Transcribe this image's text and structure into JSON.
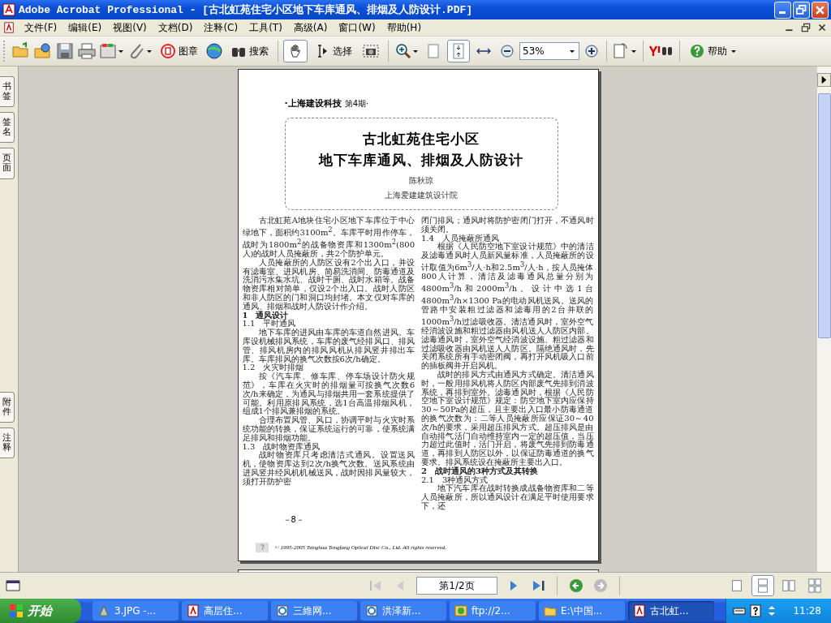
{
  "window": {
    "title": "Adobe Acrobat Professional - [古北虹苑住宅小区地下车库通风、排烟及人防设计.PDF]"
  },
  "menu": [
    "文件(F)",
    "编辑(E)",
    "视图(V)",
    "文档(D)",
    "注释(C)",
    "工具(T)",
    "高级(A)",
    "窗口(W)",
    "帮助(H)"
  ],
  "toolbar": {
    "stamp_label": "图章",
    "search_label": "搜索",
    "tools": [
      {
        "kind": "hand",
        "selected": true
      },
      {
        "kind": "select",
        "label": "选择",
        "selected": false
      },
      {
        "kind": "snapshot",
        "selected": false
      }
    ],
    "view_buttons": [
      {
        "kind": "actual",
        "selected": false
      },
      {
        "kind": "fit_page",
        "selected": true
      },
      {
        "kind": "fit_width",
        "selected": false
      }
    ],
    "zoom": "53%",
    "help_label": "帮助"
  },
  "left_panel": {
    "top_tabs": [
      "书签",
      "签名",
      "页面"
    ],
    "bottom_tabs": [
      "附件",
      "注释"
    ]
  },
  "document": {
    "journal": "·上海建设科技",
    "issue": "第4期·",
    "title_lines": [
      "古北虹苑住宅小区",
      "地下车库通风、排烟及人防设计"
    ],
    "author": "陈秋琼",
    "affiliation": "上海爱建建筑设计院",
    "columns": [
      [
        {
          "kind": "para",
          "text": "古北虹苑A地块住宅小区地下车库位于中心绿地下，面积约3100m$^{2}$。车库平时用作停车，战时为1800m$^{2}$的战备物资库和1300m$^{2}$(800人)的战时人员掩蔽所，共2个防护单元。"
        },
        {
          "kind": "para",
          "text": "人员掩蔽所的人防区设有2个出入口，并设有滤毒室、进风机房、简易洗消间、防毒通道及洗消污水集水坑、战时干厕、战时水箱等。战备物资库相对简单，仅设2个出入口。战时人防区和非人防区的门和洞口均封堵。本文仅对车库的通风、排烟和战时人防设计作介绍。"
        },
        {
          "kind": "section",
          "text": "1　通风设计"
        },
        {
          "kind": "subsection",
          "text": "1.1　平时通风"
        },
        {
          "kind": "para",
          "text": "地下车库的进风由车库的车道自然进风。车库设机械排风系统，车库的废气经排风口、排风管、排风机房内的排风风机从排风竖井排出车库。车库排风的换气次数按6次/h确定。"
        },
        {
          "kind": "subsection",
          "text": "1.2　火灾时排烟"
        },
        {
          "kind": "para",
          "text": "按《汽车库、修车库、停车场设计防火规范》，车库在火灾时的排烟量可按换气次数6次/h来确定，为通风与排烟共用一套系统提供了可能。利用原排风系统，选1台高温排烟风机，组成1个排风兼排烟的系统。"
        },
        {
          "kind": "para",
          "text": "合理布置风管、风口，协调平时与火灾时系统功能的转换，保证系统运行的可靠，使系统满足排风和排烟功能。"
        },
        {
          "kind": "subsection",
          "text": "1.3　战时物资库通风"
        },
        {
          "kind": "para",
          "text": "战时物资库只考虑清洁式通风。设置送风机，使物资库达到2次/h换气次数。送风系统由进风竖井经风机机械送风，战时因排风量较大，须打开防护密"
        }
      ],
      [
        {
          "kind": "continued",
          "text": "闭门排风；通风时将防护密闭门打开，不通风时须关闭。"
        },
        {
          "kind": "subsection",
          "text": "1.4　人员掩蔽所通风"
        },
        {
          "kind": "para",
          "text": "根据《人民防空地下室设计规范》中的清洁及滤毒通风时人员新风量标准，人员掩蔽所的设计取值为6m$^{3}$/人·h和2.5m$^{3}$/人·h，按人员掩体800人计算，清洁及滤毒通风总量分别为4800m$^{3}$/h和2000m$^{3}$/h。设计中选1台4800m$^{3}$/h×1300 Pa的电动风机送风。送风的管路中安装粗过滤器和滤毒用的2台并联的1000m$^{3}$/h过滤吸收器。清洁通风时，室外空气经消波设施和粗过滤器由风机送人人防区内部。滤毒通风时，室外空气经消波设施、粗过滤器和过滤吸收器由风机送人人防区。隔绝通风时，先关闭系统所有手动密闭阀，再打开风机吸入口前的插板阀并开启风机。"
        },
        {
          "kind": "para",
          "text": "战时的排风方式由通风方式确定。清洁通风时，一般用排风机将人防区内部废气先排到消波系统，再排到室外。滤毒通风时，根据《人民防空地下室设计规范》规定：防空地下室内应保持30～50Pa的超压，且主要出入口最小防毒通道的换气次数为：二等人员掩蔽所应保证30～40次/h的要求，采用超压排风方式。超压排风是由自动排气活门自动维持室内一定的超压值，当压力超过此值时，活门开启，将废气先排到防毒通道，再排到人防区以外，以保证防毒通道的换气要求。排风系统设在掩蔽所主要出入口。"
        },
        {
          "kind": "section",
          "text": "2　战时通风的3种方式及其转换"
        },
        {
          "kind": "subsection",
          "text": "2.1　3种通风方式"
        },
        {
          "kind": "para",
          "text": "地下汽车库在战时转换成战备物资库和二等人员掩蔽所，所以通风设计在满足平时使用要求下，还"
        }
      ]
    ],
    "page_number": "－8－",
    "copyright": "© 1995-2005 Tsinghua Tongfang Optical Disc Co., Ltd.   All rights reserved."
  },
  "navigation": {
    "page_field": "第1/2页",
    "layout_buttons": [
      {
        "kind": "single",
        "selected": false
      },
      {
        "kind": "continuous",
        "selected": true
      },
      {
        "kind": "facing",
        "selected": false
      },
      {
        "kind": "continuous_facing",
        "selected": false
      }
    ]
  },
  "taskbar": {
    "start": "开始",
    "items": [
      {
        "label": "3.JPG -...",
        "kind": "image",
        "selected": false
      },
      {
        "label": "高层住...",
        "kind": "pdf",
        "selected": false
      },
      {
        "label": "三維网...",
        "kind": "browser",
        "selected": false
      },
      {
        "label": "洪泽新...",
        "kind": "browser",
        "selected": false
      },
      {
        "label": "ftp://2...",
        "kind": "ftp",
        "selected": false
      },
      {
        "label": "E:\\中国...",
        "kind": "folder",
        "selected": false
      },
      {
        "label": "古北虹...",
        "kind": "pdf",
        "selected": true
      }
    ],
    "clock": "11:28"
  }
}
